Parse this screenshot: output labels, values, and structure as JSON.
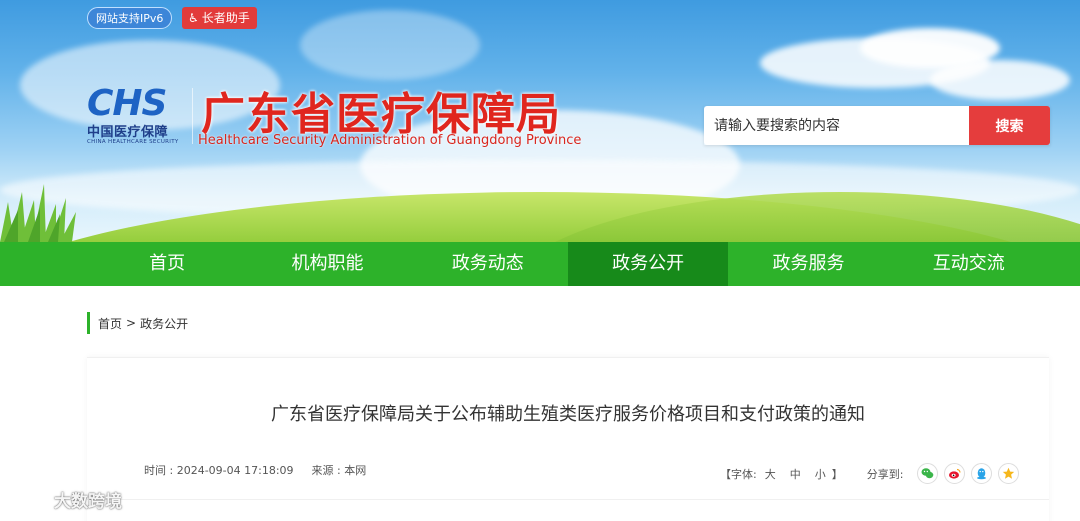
{
  "header": {
    "ipv6_label": "网站支持IPv6",
    "elder_label": "长者助手",
    "logo_mark": "CHS",
    "logo_cn": "中国医疗保障",
    "logo_en": "CHINA HEALTHCARE SECURITY",
    "site_title": "广东省医疗保障局",
    "site_subtitle": "Healthcare Security Administration of Guangdong Province",
    "search_placeholder": "请输入要搜索的内容",
    "search_button": "搜索"
  },
  "nav": {
    "items": [
      {
        "label": "首页"
      },
      {
        "label": "机构职能"
      },
      {
        "label": "政务动态"
      },
      {
        "label": "政务公开",
        "active": true
      },
      {
        "label": "政务服务"
      },
      {
        "label": "互动交流"
      }
    ]
  },
  "breadcrumb": {
    "home": "首页",
    "separator": ">",
    "current": "政务公开"
  },
  "article": {
    "title": "广东省医疗保障局关于公布辅助生殖类医疗服务价格项目和支付政策的通知",
    "time": "时间 : 2024-09-04 17:18:09",
    "source": "来源 : 本网",
    "font_open": "【字体:",
    "font_large": "大",
    "font_medium": "中",
    "font_small": "小",
    "font_close": "】",
    "share_label": "分享到:",
    "share_icons": [
      "wechat-icon",
      "weibo-icon",
      "qq-icon",
      "qzone-icon"
    ]
  },
  "watermark": {
    "text": "大数跨境"
  },
  "colors": {
    "nav_green": "#2db22a",
    "nav_active": "#178a1a",
    "title_red": "#e0261e",
    "search_red": "#e53d3d"
  }
}
